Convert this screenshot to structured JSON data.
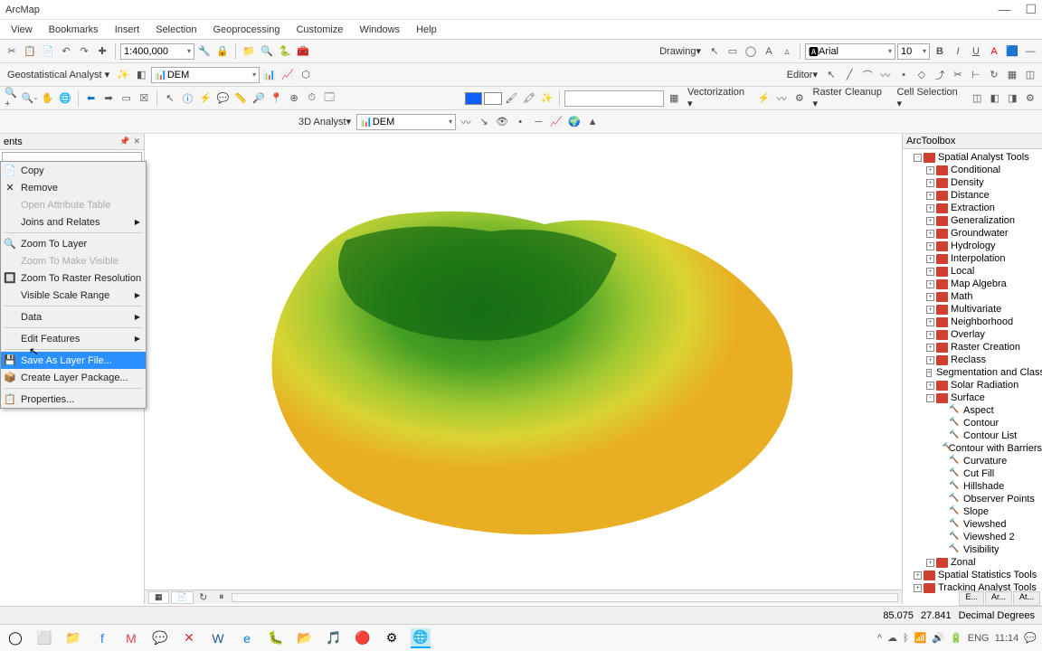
{
  "title": "ArcMap",
  "menu": [
    "View",
    "Bookmarks",
    "Insert",
    "Selection",
    "Geoprocessing",
    "Customize",
    "Windows",
    "Help"
  ],
  "tb1": {
    "scale": "1:400,000",
    "drawing_label": "Drawing",
    "font": "Arial",
    "fontsize": "10"
  },
  "tb2": {
    "geostat": "Geostatistical Analyst",
    "layer1": "DEM",
    "editor": "Editor"
  },
  "tb3": {
    "vectorization": "Vectorization",
    "raster_cleanup": "Raster Cleanup",
    "cell_selection": "Cell Selection"
  },
  "tb4": {
    "analyst3d": "3D Analyst",
    "layer": "DEM"
  },
  "toc": {
    "title": "ents"
  },
  "context": [
    {
      "label": "Copy",
      "icon": "📄"
    },
    {
      "label": "Remove",
      "icon": "✕"
    },
    {
      "label": "Open Attribute Table",
      "disabled": true
    },
    {
      "label": "Joins and Relates",
      "arrow": true
    },
    {
      "sep": true
    },
    {
      "label": "Zoom To Layer",
      "icon": "🔍"
    },
    {
      "label": "Zoom To Make Visible",
      "disabled": true
    },
    {
      "label": "Zoom To Raster Resolution",
      "icon": "🔲"
    },
    {
      "label": "Visible Scale Range",
      "arrow": true
    },
    {
      "sep": true
    },
    {
      "label": "Data",
      "arrow": true
    },
    {
      "sep": true
    },
    {
      "label": "Edit Features",
      "arrow": true
    },
    {
      "sep": true
    },
    {
      "label": "Save As Layer File...",
      "icon": "💾",
      "hl": true
    },
    {
      "label": "Create Layer Package...",
      "icon": "📦"
    },
    {
      "sep": true
    },
    {
      "label": "Properties...",
      "icon": "📋"
    }
  ],
  "arctoolbox": {
    "title": "ArcToolbox",
    "tree": [
      {
        "d": 1,
        "e": "-",
        "t": "toolbox",
        "l": "Spatial Analyst Tools"
      },
      {
        "d": 2,
        "e": "+",
        "t": "toolset",
        "l": "Conditional"
      },
      {
        "d": 2,
        "e": "+",
        "t": "toolset",
        "l": "Density"
      },
      {
        "d": 2,
        "e": "+",
        "t": "toolset",
        "l": "Distance"
      },
      {
        "d": 2,
        "e": "+",
        "t": "toolset",
        "l": "Extraction"
      },
      {
        "d": 2,
        "e": "+",
        "t": "toolset",
        "l": "Generalization"
      },
      {
        "d": 2,
        "e": "+",
        "t": "toolset",
        "l": "Groundwater"
      },
      {
        "d": 2,
        "e": "+",
        "t": "toolset",
        "l": "Hydrology"
      },
      {
        "d": 2,
        "e": "+",
        "t": "toolset",
        "l": "Interpolation"
      },
      {
        "d": 2,
        "e": "+",
        "t": "toolset",
        "l": "Local"
      },
      {
        "d": 2,
        "e": "+",
        "t": "toolset",
        "l": "Map Algebra"
      },
      {
        "d": 2,
        "e": "+",
        "t": "toolset",
        "l": "Math"
      },
      {
        "d": 2,
        "e": "+",
        "t": "toolset",
        "l": "Multivariate"
      },
      {
        "d": 2,
        "e": "+",
        "t": "toolset",
        "l": "Neighborhood"
      },
      {
        "d": 2,
        "e": "+",
        "t": "toolset",
        "l": "Overlay"
      },
      {
        "d": 2,
        "e": "+",
        "t": "toolset",
        "l": "Raster Creation"
      },
      {
        "d": 2,
        "e": "+",
        "t": "toolset",
        "l": "Reclass"
      },
      {
        "d": 2,
        "e": "+",
        "t": "toolset",
        "l": "Segmentation and Classi"
      },
      {
        "d": 2,
        "e": "+",
        "t": "toolset",
        "l": "Solar Radiation"
      },
      {
        "d": 2,
        "e": "-",
        "t": "toolset",
        "l": "Surface"
      },
      {
        "d": 3,
        "t": "tool",
        "l": "Aspect"
      },
      {
        "d": 3,
        "t": "tool",
        "l": "Contour"
      },
      {
        "d": 3,
        "t": "tool",
        "l": "Contour List"
      },
      {
        "d": 3,
        "t": "tool",
        "l": "Contour with Barriers"
      },
      {
        "d": 3,
        "t": "tool",
        "l": "Curvature"
      },
      {
        "d": 3,
        "t": "tool",
        "l": "Cut Fill"
      },
      {
        "d": 3,
        "t": "tool",
        "l": "Hillshade"
      },
      {
        "d": 3,
        "t": "tool",
        "l": "Observer Points"
      },
      {
        "d": 3,
        "t": "tool",
        "l": "Slope"
      },
      {
        "d": 3,
        "t": "tool",
        "l": "Viewshed"
      },
      {
        "d": 3,
        "t": "tool",
        "l": "Viewshed 2"
      },
      {
        "d": 3,
        "t": "tool",
        "l": "Visibility"
      },
      {
        "d": 2,
        "e": "+",
        "t": "toolset",
        "l": "Zonal"
      },
      {
        "d": 1,
        "e": "+",
        "t": "toolbox",
        "l": "Spatial Statistics Tools"
      },
      {
        "d": 1,
        "e": "+",
        "t": "toolbox",
        "l": "Tracking Analyst Tools"
      }
    ]
  },
  "status": {
    "x": "85.075",
    "y": "27.841",
    "units": "Decimal Degrees"
  },
  "panel_tabs": [
    "E...",
    "Ar...",
    "At..."
  ],
  "taskbar": {
    "apps": [
      "⊞",
      "⬜",
      "📁",
      "📘",
      "✉",
      "🌐",
      "❌",
      "📄",
      "🌐",
      "🐛",
      "🌐",
      "🎵",
      "🔵",
      "🎯"
    ],
    "time": "11:14"
  }
}
